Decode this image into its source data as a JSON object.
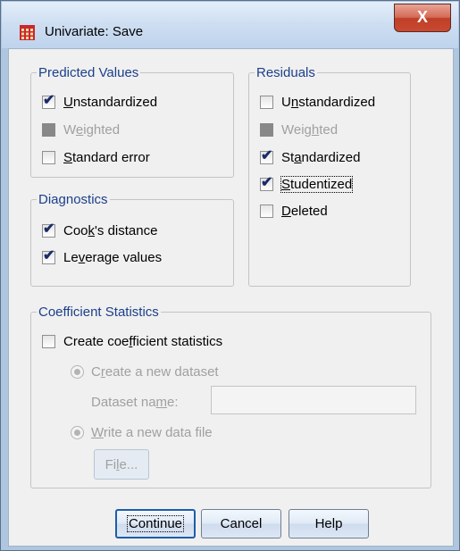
{
  "window": {
    "title": "Univariate: Save",
    "close_label": "X"
  },
  "predicted": {
    "legend": "Predicted Values",
    "items": [
      {
        "pre": "",
        "u": "U",
        "post": "nstandardized",
        "checked": true,
        "disabled": false
      },
      {
        "pre": "W",
        "u": "e",
        "post": "ighted",
        "checked": false,
        "disabled": true
      },
      {
        "pre": "",
        "u": "S",
        "post": "tandard error",
        "checked": false,
        "disabled": false
      }
    ]
  },
  "residuals": {
    "legend": "Residuals",
    "items": [
      {
        "pre": "U",
        "u": "n",
        "post": "standardized",
        "checked": false,
        "disabled": false
      },
      {
        "pre": "Weig",
        "u": "h",
        "post": "ted",
        "checked": false,
        "disabled": true
      },
      {
        "pre": "St",
        "u": "a",
        "post": "ndardized",
        "checked": true,
        "disabled": false
      },
      {
        "pre": "",
        "u": "S",
        "post": "tudentized",
        "checked": true,
        "disabled": false
      },
      {
        "pre": "",
        "u": "D",
        "post": "eleted",
        "checked": false,
        "disabled": false
      }
    ]
  },
  "diagnostics": {
    "legend": "Diagnostics",
    "items": [
      {
        "pre": "Coo",
        "u": "k",
        "post": "'s distance",
        "checked": true
      },
      {
        "pre": "Le",
        "u": "v",
        "post": "erage values",
        "checked": true
      }
    ]
  },
  "coefficient": {
    "legend": "Coefficient Statistics",
    "create": {
      "pre": "Create coe",
      "u": "f",
      "post": "ficient statistics",
      "checked": false
    },
    "new_dataset": {
      "pre": "C",
      "u": "r",
      "post": "eate a new dataset",
      "selected": true
    },
    "dataset_name": {
      "pre": "Dataset na",
      "u": "m",
      "post": "e:",
      "value": ""
    },
    "data_file": {
      "pre": "",
      "u": "W",
      "post": "rite a new data file",
      "selected": false
    },
    "file_button": {
      "pre": "Fi",
      "u": "l",
      "post": "e..."
    }
  },
  "buttons": {
    "continue": "Continue",
    "cancel": "Cancel",
    "help": "Help"
  }
}
